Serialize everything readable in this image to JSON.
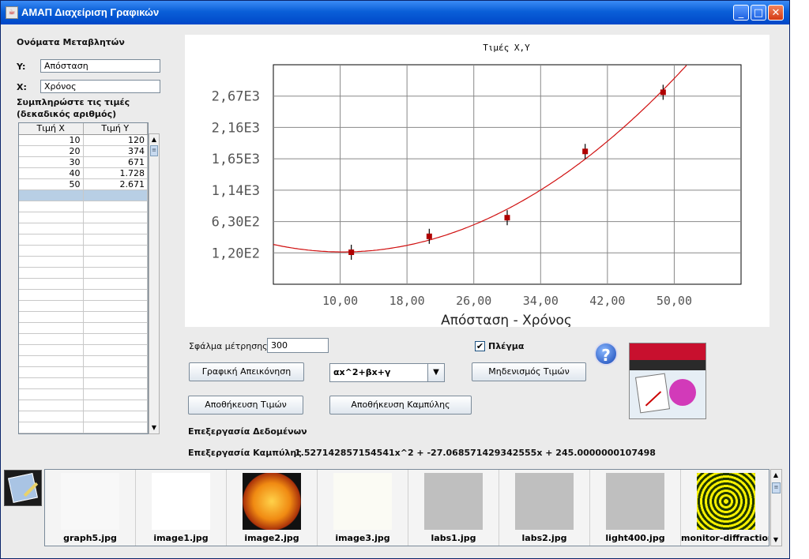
{
  "window": {
    "title": "AMAΠ Διαχείριση Γραφικών",
    "minimize": "_",
    "maximize": "□",
    "close": "✕"
  },
  "variables": {
    "heading": "Ονόματα Μεταβλητών",
    "y_label": "Y:",
    "y_value": "Απόσταση",
    "x_label": "X:",
    "x_value": "Χρόνος",
    "fill_hint_1": "Συμπληρώστε τις τιμές",
    "fill_hint_2": "(δεκαδικός αριθμός)"
  },
  "table": {
    "headers": [
      "Τιμή X",
      "Τιμή Y"
    ],
    "rows": [
      [
        "10",
        "120"
      ],
      [
        "20",
        "374"
      ],
      [
        "30",
        "671"
      ],
      [
        "40",
        "1.728"
      ],
      [
        "50",
        "2.671"
      ]
    ]
  },
  "controls": {
    "error_label": "Σφάλμα μέτρησης",
    "error_value": "300",
    "grid_label": "Πλέγμα",
    "grid_checked": "✔",
    "plot_button": "Γραφική Απεικόνηση",
    "fit_combo": "αx^2+βx+γ",
    "reset_button": "Μηδενισμός Τιμών",
    "save_values_button": "Αποθήκευση Τιμών",
    "save_curve_button": "Αποθήκευση Καμπύλης",
    "help": "?",
    "data_processing": "Επεξεργασία Δεδομένων",
    "curve_processing_label": "Επεξεργασία Καμπύλης",
    "curve_equation": "1.527142857154541x^2 + -27.068571429342555x + 245.0000000107498"
  },
  "chart_data": {
    "type": "scatter",
    "title": "Τιμές X,Y",
    "xlabel": "Απόσταση - Χρόνος",
    "x": [
      10,
      20,
      30,
      40,
      50
    ],
    "y": [
      120,
      374,
      671,
      1728,
      2671
    ],
    "error_bars": 300,
    "fit": {
      "a": 1.527142857154541,
      "b": -27.068571429342555,
      "c": 245.0000000107498
    },
    "xticks": [
      "10,00",
      "18,00",
      "26,00",
      "34,00",
      "42,00",
      "50,00"
    ],
    "yticks": [
      "1,20E2",
      "6,30E2",
      "1,14E3",
      "1,65E3",
      "2,16E3",
      "2,67E3"
    ],
    "xlim": [
      0,
      60
    ],
    "ylim": [
      -390,
      3110
    ],
    "grid": true
  },
  "thumbnails": [
    "graph5.jpg",
    "image1.jpg",
    "image2.jpg",
    "image3.jpg",
    "labs1.jpg",
    "labs2.jpg",
    "light400.jpg",
    "monitor-diffraction..."
  ]
}
